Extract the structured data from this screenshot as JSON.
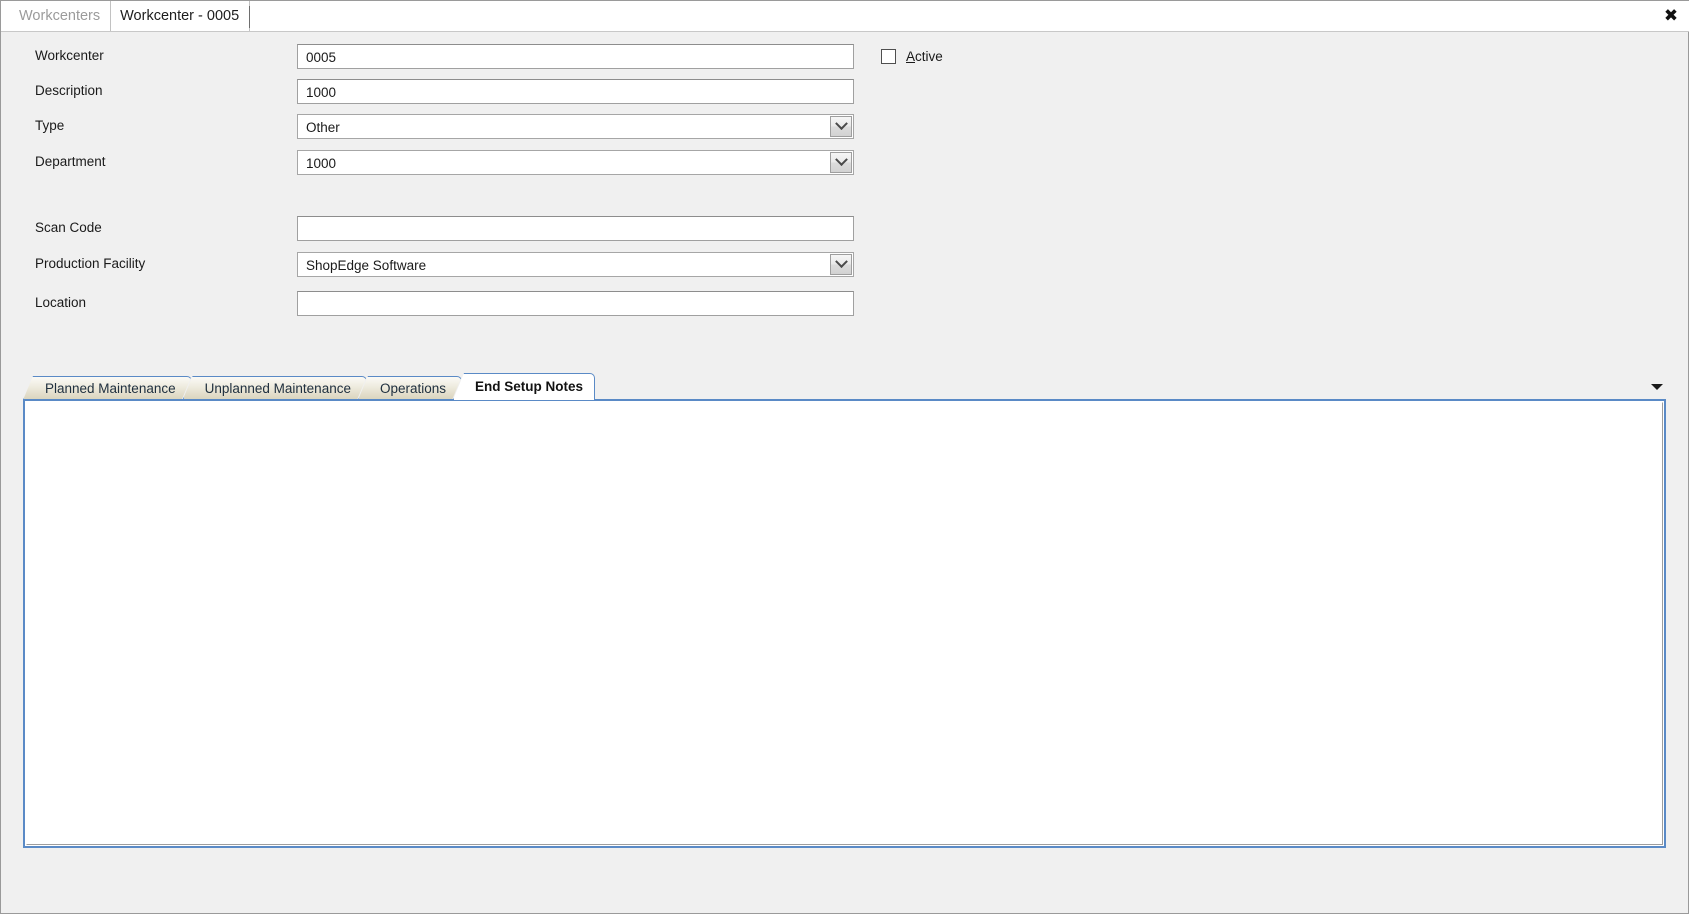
{
  "window": {
    "close_label": "✖"
  },
  "document_tabs": [
    {
      "label": "Workcenters",
      "active": false
    },
    {
      "label": "Workcenter - 0005",
      "active": true
    }
  ],
  "form": {
    "fields": [
      {
        "label": "Workcenter",
        "type": "text",
        "value": "0005",
        "placeholder": ""
      },
      {
        "label": "Description",
        "type": "text",
        "value": "1000",
        "placeholder": ""
      },
      {
        "label": "Type",
        "type": "combo",
        "value": "Other",
        "placeholder": ""
      },
      {
        "label": "Department",
        "type": "combo",
        "value": "1000",
        "placeholder": ""
      },
      {
        "label": "Scan Code",
        "type": "text",
        "value": "",
        "placeholder": ""
      },
      {
        "label": "Production Facility",
        "type": "combo",
        "value": "ShopEdge Software",
        "placeholder": ""
      },
      {
        "label": "Location",
        "type": "text",
        "value": "",
        "placeholder": ""
      }
    ],
    "active_checkbox": {
      "accel": "A",
      "rest": "ctive",
      "checked": false
    }
  },
  "tab_control": {
    "tabs": [
      {
        "label": "Planned Maintenance",
        "active": false
      },
      {
        "label": "Unplanned Maintenance",
        "active": false
      },
      {
        "label": "Operations",
        "active": false
      },
      {
        "label": "End Setup Notes",
        "active": true
      }
    ],
    "overflow_icon": "chevron-down-icon",
    "panel_content": ""
  },
  "colors": {
    "window_bg": "#f0f0f0",
    "tab_border_blue": "#5a8ac6",
    "tab_inactive_top": "#fbfaf6",
    "tab_inactive_bottom": "#d9d3bc",
    "text": "#1a1a1a",
    "inactive_tab_text": "#9b9b9b"
  }
}
